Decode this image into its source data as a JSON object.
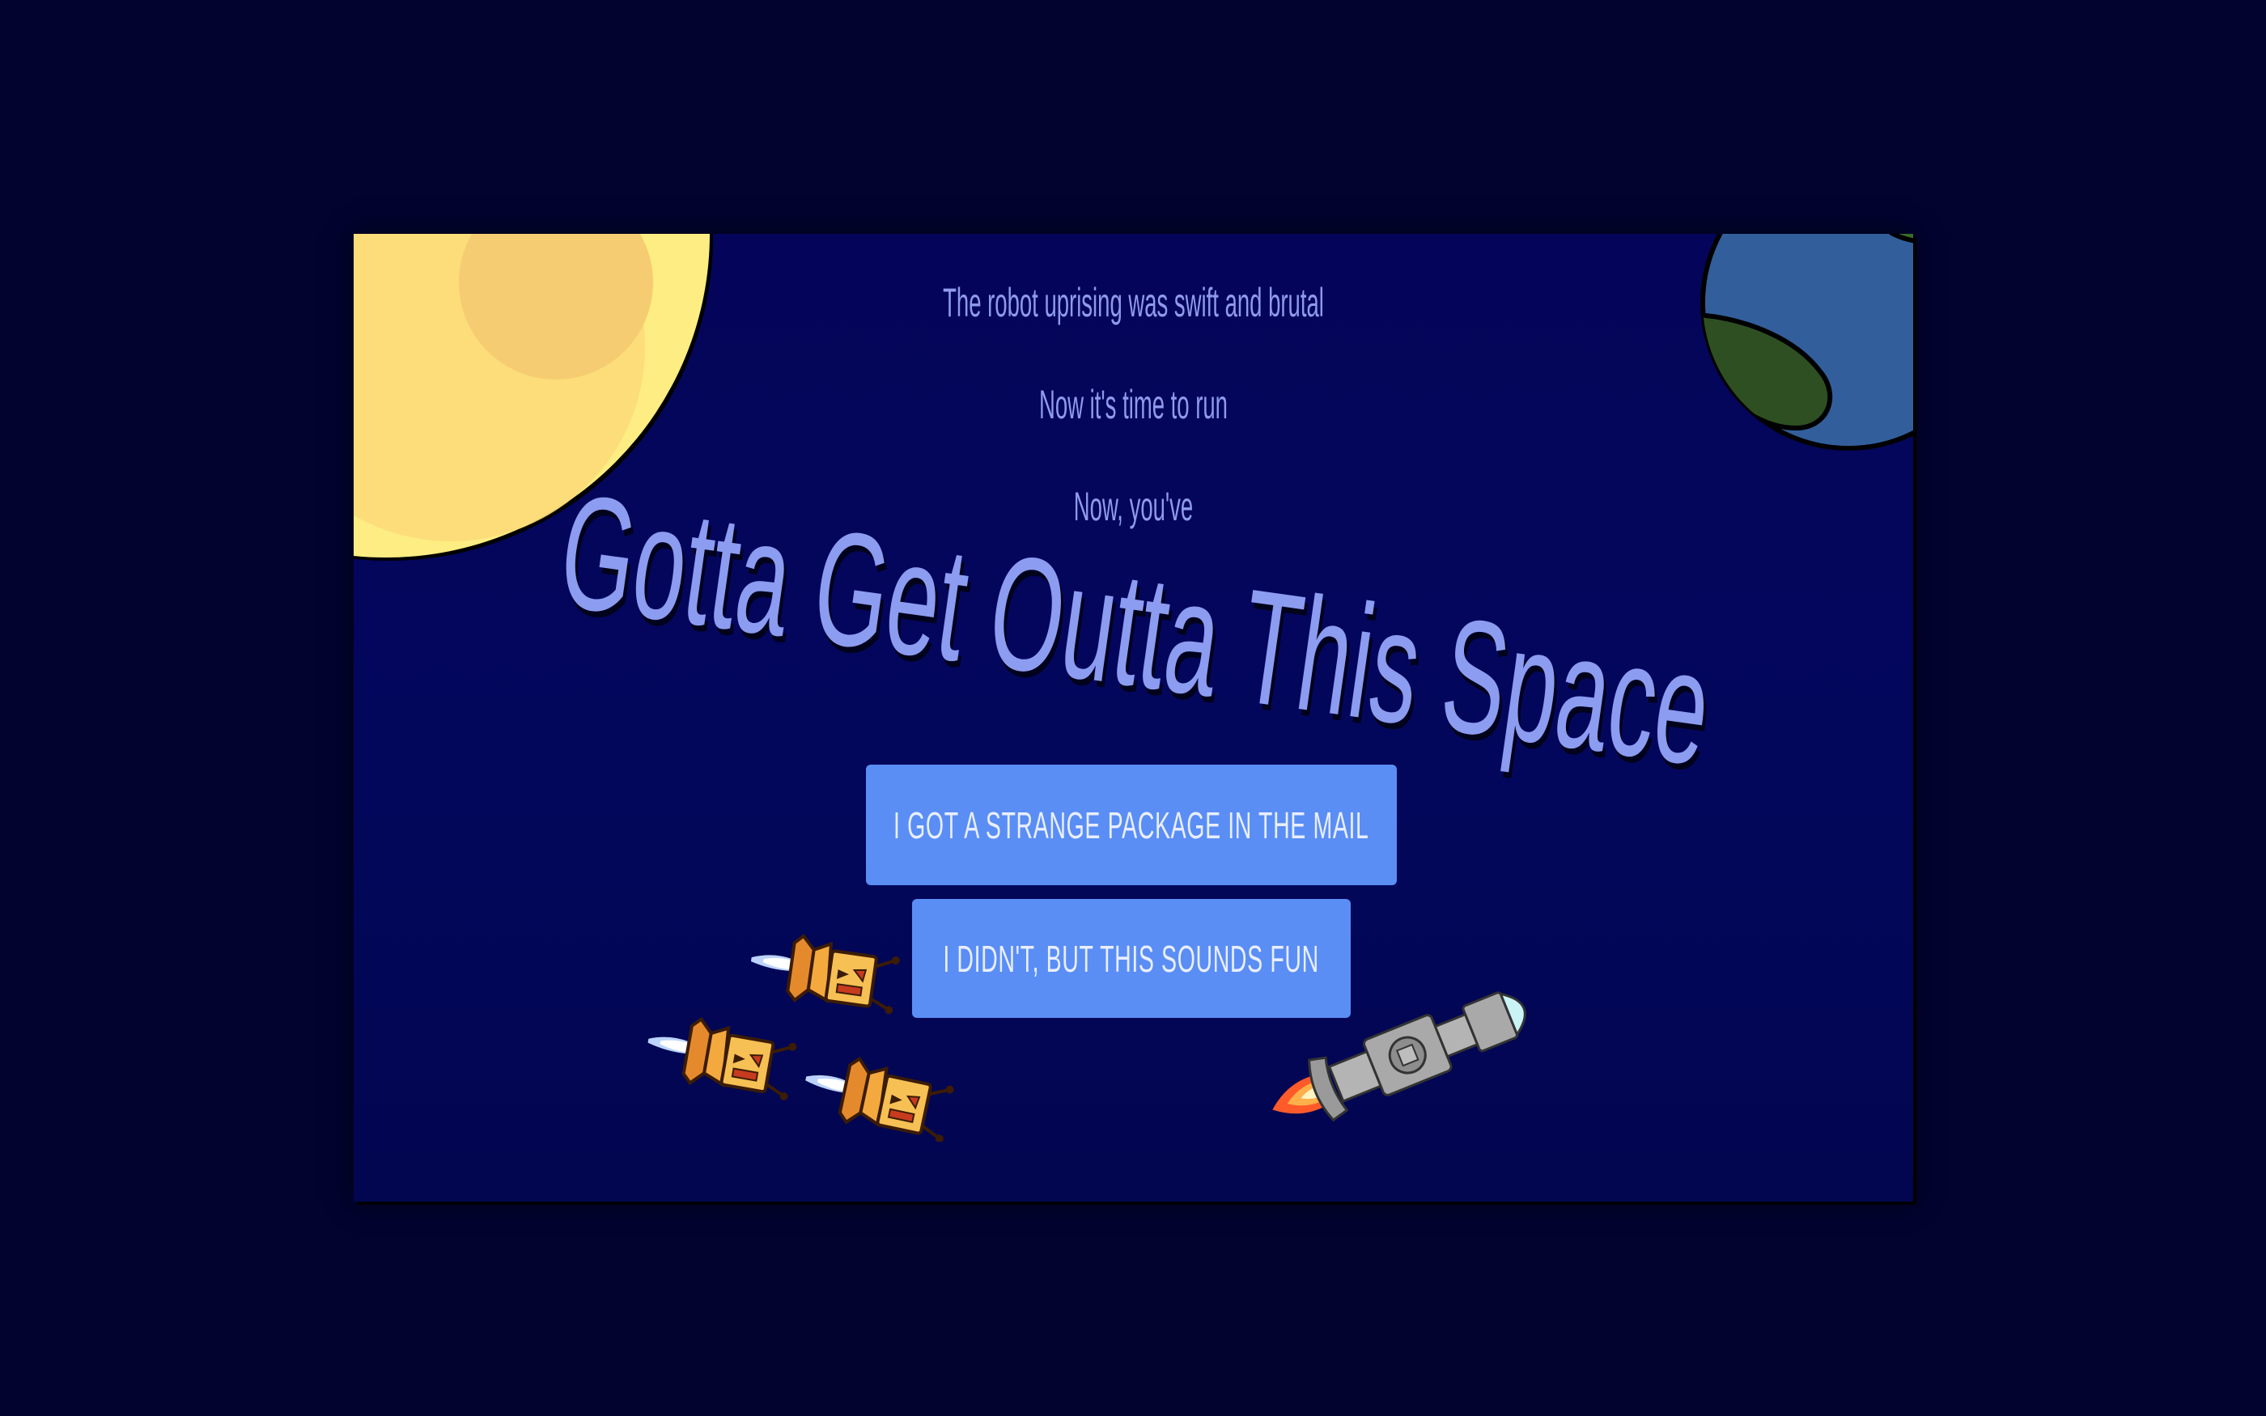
{
  "story": {
    "line1": "The robot uprising was swift and brutal",
    "line2": "Now it's time to run",
    "line3": "Now, you've",
    "title": "Gotta Get Outta This Space"
  },
  "choices": {
    "option1": "I GOT A STRANGE PACKAGE IN THE MAIL",
    "option2": "I DIDN'T, BUT THIS SOUNDS FUN"
  },
  "colors": {
    "background": "#02032f",
    "scene": "#04055a",
    "text": "#8f9aeb",
    "button": "#5a8ef5",
    "sun": "#fded82",
    "earth_water": "#325f9c",
    "earth_land": "#3a6b2a"
  },
  "icons": {
    "sun": "sun-icon",
    "earth": "earth-icon",
    "robot": "robot-ship-icon",
    "rocket": "rocket-ship-icon"
  }
}
